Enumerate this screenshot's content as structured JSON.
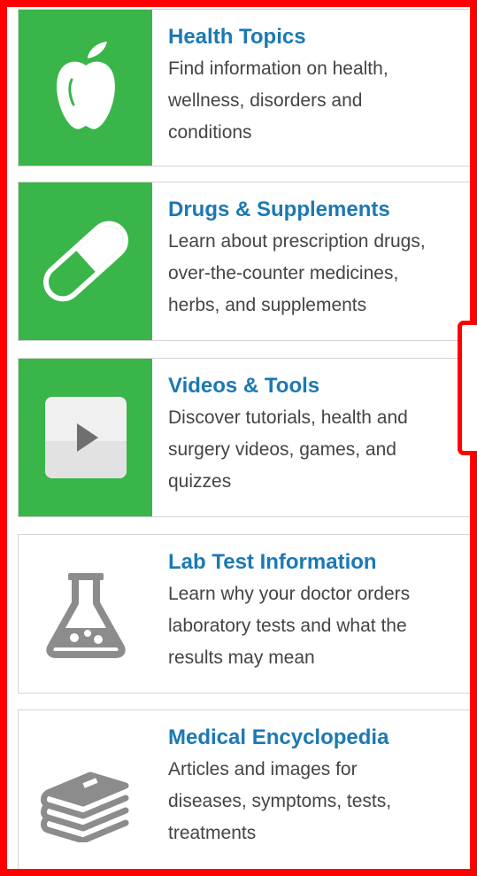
{
  "cards": [
    {
      "title": "Health Topics",
      "lines": [
        "Find information on health,",
        "wellness, disorders and",
        "conditions"
      ],
      "icon": "apple-icon"
    },
    {
      "title": "Drugs & Supplements",
      "lines": [
        "Learn about prescription drugs,",
        "over-the-counter medicines,",
        "herbs, and supplements"
      ],
      "icon": "pill-capsule-icon"
    },
    {
      "title": "Videos & Tools",
      "lines": [
        "Discover tutorials, health and",
        "surgery videos, games, and",
        "quizzes"
      ],
      "icon": "video-play-icon"
    },
    {
      "title": "Lab Test Information",
      "lines": [
        "Learn why your doctor orders",
        "laboratory tests and what the",
        "results may mean"
      ],
      "icon": "lab-flask-icon"
    },
    {
      "title": "Medical Encyclopedia",
      "lines": [
        "Articles and images for",
        "diseases, symptoms, tests,",
        "treatments"
      ],
      "icon": "books-stack-icon"
    }
  ],
  "colors": {
    "green": "#3ab54a",
    "title_blue": "#1b79b3",
    "frame_red": "#ff0000",
    "icon_gray": "#8c8c8c"
  }
}
